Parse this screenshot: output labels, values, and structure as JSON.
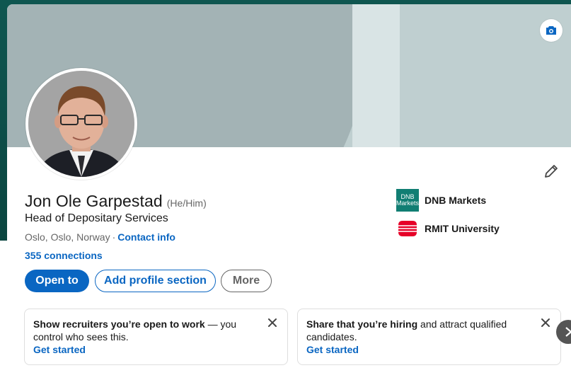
{
  "profile": {
    "name": "Jon Ole Garpestad",
    "pronouns": "(He/Him)",
    "headline": "Head of Depositary Services",
    "location": "Oslo, Oslo, Norway",
    "separator": "·",
    "contact_info": "Contact info",
    "connections": "355 connections"
  },
  "actions": {
    "open_to": "Open to",
    "add_section": "Add profile section",
    "more": "More"
  },
  "organizations": [
    {
      "name": "DNB Markets",
      "logo_text_top": "DNB",
      "logo_text_bottom": "Markets",
      "icon": "dnb-markets-logo"
    },
    {
      "name": "RMIT University",
      "icon": "rmit-logo"
    }
  ],
  "cards": [
    {
      "bold": "Show recruiters you’re open to work",
      "rest": " — you control who sees this.",
      "link": "Get started"
    },
    {
      "bold": "Share that you’re hiring",
      "rest": " and attract qualified candidates.",
      "link": "Get started"
    }
  ],
  "icons": {
    "camera": "camera-icon",
    "edit": "pencil-icon",
    "close": "close-icon",
    "next": "chevron-right-icon"
  },
  "colors": {
    "accent": "#0a66c2",
    "banner": "#bfcfd0",
    "dnb_green": "#117e73",
    "rmit_red": "#e60028"
  }
}
